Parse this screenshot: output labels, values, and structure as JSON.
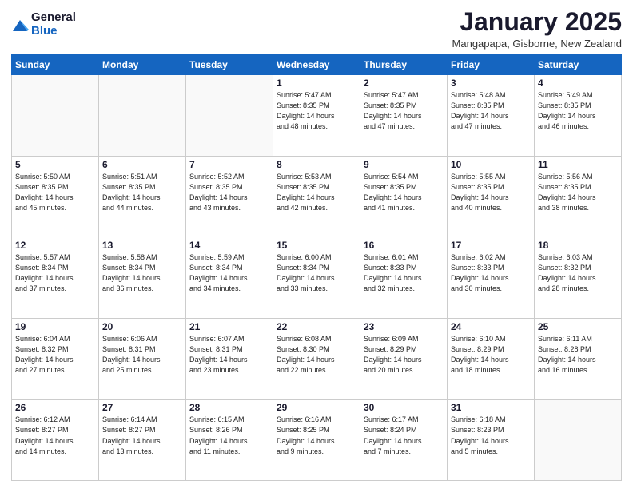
{
  "logo": {
    "general": "General",
    "blue": "Blue"
  },
  "title": "January 2025",
  "location": "Mangapapa, Gisborne, New Zealand",
  "days_header": [
    "Sunday",
    "Monday",
    "Tuesday",
    "Wednesday",
    "Thursday",
    "Friday",
    "Saturday"
  ],
  "weeks": [
    [
      {
        "day": "",
        "info": ""
      },
      {
        "day": "",
        "info": ""
      },
      {
        "day": "",
        "info": ""
      },
      {
        "day": "1",
        "info": "Sunrise: 5:47 AM\nSunset: 8:35 PM\nDaylight: 14 hours\nand 48 minutes."
      },
      {
        "day": "2",
        "info": "Sunrise: 5:47 AM\nSunset: 8:35 PM\nDaylight: 14 hours\nand 47 minutes."
      },
      {
        "day": "3",
        "info": "Sunrise: 5:48 AM\nSunset: 8:35 PM\nDaylight: 14 hours\nand 47 minutes."
      },
      {
        "day": "4",
        "info": "Sunrise: 5:49 AM\nSunset: 8:35 PM\nDaylight: 14 hours\nand 46 minutes."
      }
    ],
    [
      {
        "day": "5",
        "info": "Sunrise: 5:50 AM\nSunset: 8:35 PM\nDaylight: 14 hours\nand 45 minutes."
      },
      {
        "day": "6",
        "info": "Sunrise: 5:51 AM\nSunset: 8:35 PM\nDaylight: 14 hours\nand 44 minutes."
      },
      {
        "day": "7",
        "info": "Sunrise: 5:52 AM\nSunset: 8:35 PM\nDaylight: 14 hours\nand 43 minutes."
      },
      {
        "day": "8",
        "info": "Sunrise: 5:53 AM\nSunset: 8:35 PM\nDaylight: 14 hours\nand 42 minutes."
      },
      {
        "day": "9",
        "info": "Sunrise: 5:54 AM\nSunset: 8:35 PM\nDaylight: 14 hours\nand 41 minutes."
      },
      {
        "day": "10",
        "info": "Sunrise: 5:55 AM\nSunset: 8:35 PM\nDaylight: 14 hours\nand 40 minutes."
      },
      {
        "day": "11",
        "info": "Sunrise: 5:56 AM\nSunset: 8:35 PM\nDaylight: 14 hours\nand 38 minutes."
      }
    ],
    [
      {
        "day": "12",
        "info": "Sunrise: 5:57 AM\nSunset: 8:34 PM\nDaylight: 14 hours\nand 37 minutes."
      },
      {
        "day": "13",
        "info": "Sunrise: 5:58 AM\nSunset: 8:34 PM\nDaylight: 14 hours\nand 36 minutes."
      },
      {
        "day": "14",
        "info": "Sunrise: 5:59 AM\nSunset: 8:34 PM\nDaylight: 14 hours\nand 34 minutes."
      },
      {
        "day": "15",
        "info": "Sunrise: 6:00 AM\nSunset: 8:34 PM\nDaylight: 14 hours\nand 33 minutes."
      },
      {
        "day": "16",
        "info": "Sunrise: 6:01 AM\nSunset: 8:33 PM\nDaylight: 14 hours\nand 32 minutes."
      },
      {
        "day": "17",
        "info": "Sunrise: 6:02 AM\nSunset: 8:33 PM\nDaylight: 14 hours\nand 30 minutes."
      },
      {
        "day": "18",
        "info": "Sunrise: 6:03 AM\nSunset: 8:32 PM\nDaylight: 14 hours\nand 28 minutes."
      }
    ],
    [
      {
        "day": "19",
        "info": "Sunrise: 6:04 AM\nSunset: 8:32 PM\nDaylight: 14 hours\nand 27 minutes."
      },
      {
        "day": "20",
        "info": "Sunrise: 6:06 AM\nSunset: 8:31 PM\nDaylight: 14 hours\nand 25 minutes."
      },
      {
        "day": "21",
        "info": "Sunrise: 6:07 AM\nSunset: 8:31 PM\nDaylight: 14 hours\nand 23 minutes."
      },
      {
        "day": "22",
        "info": "Sunrise: 6:08 AM\nSunset: 8:30 PM\nDaylight: 14 hours\nand 22 minutes."
      },
      {
        "day": "23",
        "info": "Sunrise: 6:09 AM\nSunset: 8:29 PM\nDaylight: 14 hours\nand 20 minutes."
      },
      {
        "day": "24",
        "info": "Sunrise: 6:10 AM\nSunset: 8:29 PM\nDaylight: 14 hours\nand 18 minutes."
      },
      {
        "day": "25",
        "info": "Sunrise: 6:11 AM\nSunset: 8:28 PM\nDaylight: 14 hours\nand 16 minutes."
      }
    ],
    [
      {
        "day": "26",
        "info": "Sunrise: 6:12 AM\nSunset: 8:27 PM\nDaylight: 14 hours\nand 14 minutes."
      },
      {
        "day": "27",
        "info": "Sunrise: 6:14 AM\nSunset: 8:27 PM\nDaylight: 14 hours\nand 13 minutes."
      },
      {
        "day": "28",
        "info": "Sunrise: 6:15 AM\nSunset: 8:26 PM\nDaylight: 14 hours\nand 11 minutes."
      },
      {
        "day": "29",
        "info": "Sunrise: 6:16 AM\nSunset: 8:25 PM\nDaylight: 14 hours\nand 9 minutes."
      },
      {
        "day": "30",
        "info": "Sunrise: 6:17 AM\nSunset: 8:24 PM\nDaylight: 14 hours\nand 7 minutes."
      },
      {
        "day": "31",
        "info": "Sunrise: 6:18 AM\nSunset: 8:23 PM\nDaylight: 14 hours\nand 5 minutes."
      },
      {
        "day": "",
        "info": ""
      }
    ]
  ]
}
